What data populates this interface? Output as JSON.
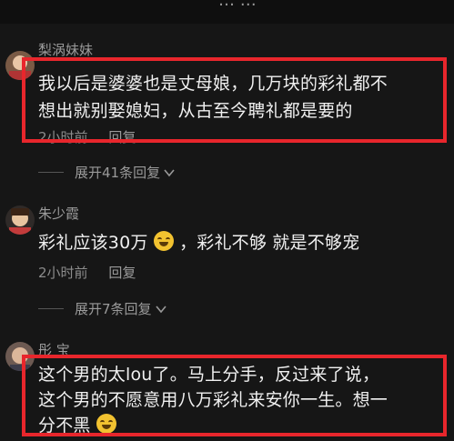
{
  "header": {
    "partial_text": "… …"
  },
  "comments": [
    {
      "username": "梨涡妹妹",
      "text_lines": [
        "我以后是婆婆也是丈母娘，几万块的彩礼都不",
        "想出就别娶媳妇，从古至今聘礼都是要的"
      ],
      "time": "2小时前",
      "reply": "回复",
      "expand": "展开41条回复"
    },
    {
      "username": "朱少霞",
      "text_before_emoji": "彩礼应该30万",
      "text_after_emoji": "，彩礼不够 就是不够宠",
      "time": "2小时前",
      "reply": "回复",
      "expand": "展开7条回复"
    },
    {
      "username": "彤 宝",
      "text_lines": [
        "这个男的太lou了。马上分手，反过来了说，",
        "这个男的不愿意用八万彩礼来安你一生。想一",
        "分不黑"
      ]
    }
  ],
  "colors": {
    "highlight": "#e8262c",
    "background": "#161616"
  }
}
